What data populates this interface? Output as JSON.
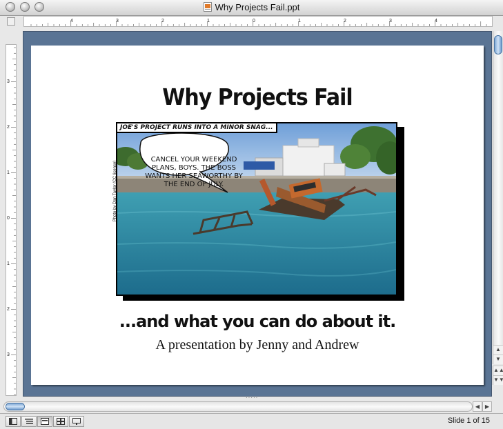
{
  "window": {
    "title": "Why Projects Fail.ppt",
    "doc_icon": "powerpoint-document-icon"
  },
  "ruler": {
    "horizontal_labels": [
      "4",
      "3",
      "2",
      "1",
      "0",
      "1",
      "2",
      "3",
      "4"
    ],
    "vertical_labels": [
      "3",
      "2",
      "1",
      "0",
      "1",
      "2",
      "3"
    ]
  },
  "slide": {
    "title": "Why Projects Fail",
    "photo_caption": "JOE'S PROJECT RUNS INTO A MINOR SNAG...",
    "speech_bubble": "CANCEL YOUR WEEKEND PLANS, BOYS. THE BOSS WANTS HER SEAWORTHY BY THE END OF JULY.",
    "photo_credit": "Photo by Dan Taylor (CC license)",
    "subtitle": "...and what you can do about it.",
    "byline": "A presentation by Jenny and Andrew",
    "background_color": "#5a7494"
  },
  "status": {
    "slide_counter": "Slide 1 of 15",
    "view_buttons": [
      "normal-view-icon",
      "outline-view-icon",
      "slide-view-icon",
      "slide-sorter-view-icon",
      "slide-show-icon"
    ],
    "active_view": "slide-view-icon"
  }
}
